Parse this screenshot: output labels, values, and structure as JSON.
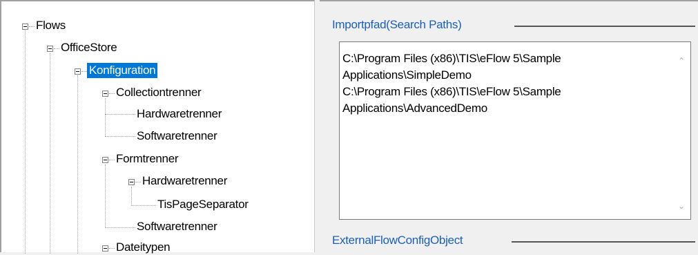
{
  "tree": {
    "root": "Flows",
    "office_store": "OfficeStore",
    "konfiguration": "Konfiguration",
    "collectiontrenner": "Collectiontrenner",
    "ct_hardwaretrenner": "Hardwaretrenner",
    "ct_softwaretrenner": "Softwaretrenner",
    "formtrenner": "Formtrenner",
    "ft_hardwaretrenner": "Hardwaretrenner",
    "tis_page_separator": "TisPageSeparator",
    "ft_softwaretrenner": "Softwaretrenner",
    "dateitypen": "Dateitypen"
  },
  "properties": {
    "search_paths_legend": "Importpfad(Search Paths)",
    "search_paths_lines": [
      "C:\\Program Files (x86)\\TIS\\eFlow 5\\Sample",
      "Applications\\SimpleDemo",
      "C:\\Program Files (x86)\\TIS\\eFlow 5\\Sample",
      "Applications\\AdvancedDemo"
    ],
    "external_legend": "ExternalFlowConfigObject"
  },
  "icons": {
    "scroll_up": "chevron-up-icon",
    "scroll_down": "chevron-down-icon",
    "expander": "minus-box-icon"
  },
  "colors": {
    "selection": "#0078d7",
    "legend_text": "#1b5fb8"
  }
}
